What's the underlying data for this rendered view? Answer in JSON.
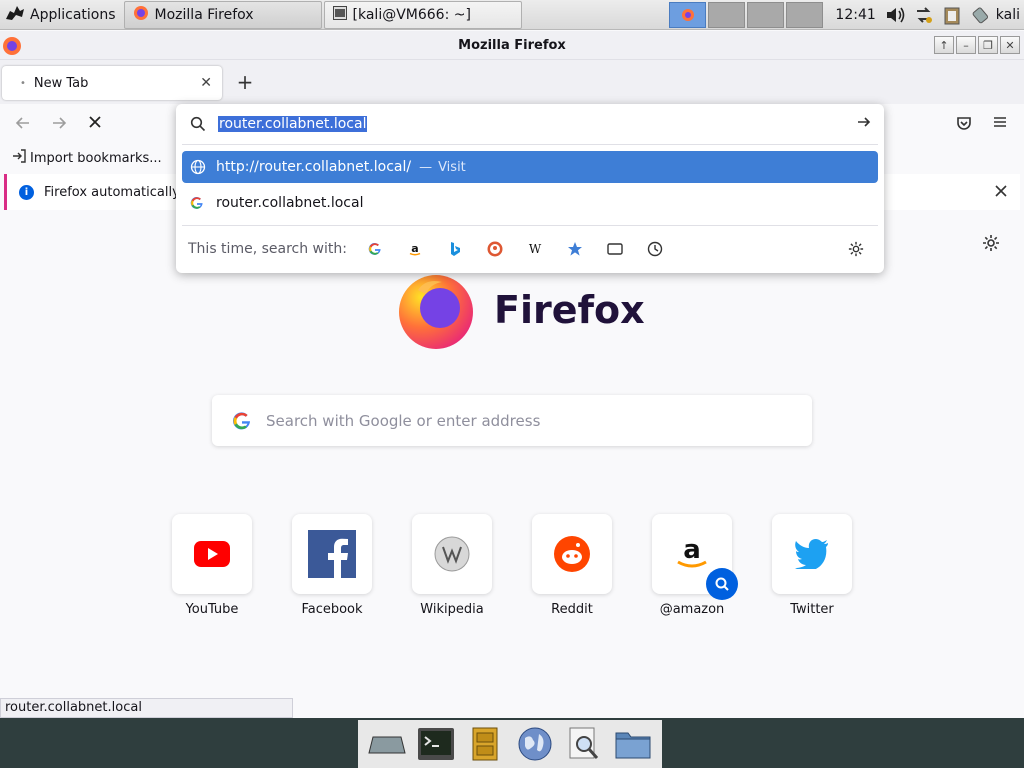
{
  "panel": {
    "apps_label": "Applications",
    "tasks": [
      {
        "label": "Mozilla Firefox",
        "active": true
      },
      {
        "label": "[kali@VM666: ~]",
        "active": false
      }
    ],
    "clock": "12:41",
    "user": "kali"
  },
  "window": {
    "title": "Mozilla Firefox"
  },
  "tabs": [
    {
      "label": "New Tab"
    }
  ],
  "urlbar": {
    "value": "router.collabnet.local",
    "results": [
      {
        "text": "http://router.collabnet.local/",
        "action": "Visit",
        "selected": true,
        "icon": "globe-icon"
      },
      {
        "text": "router.collabnet.local",
        "action": "",
        "selected": false,
        "icon": "google-icon"
      }
    ],
    "search_with_label": "This time, search with:",
    "engines": [
      "google-icon",
      "amazon-icon",
      "bing-icon",
      "duckduckgo-icon",
      "wikipedia-icon",
      "bookmarks-icon",
      "tabs-icon",
      "history-icon"
    ]
  },
  "bookmarks": {
    "import_label": "Import bookmarks..."
  },
  "notification": {
    "text": "Firefox automatically"
  },
  "newtab": {
    "brand": "Firefox",
    "search_placeholder": "Search with Google or enter address",
    "shortcuts": [
      {
        "label": "YouTube",
        "icon": "youtube-icon"
      },
      {
        "label": "Facebook",
        "icon": "facebook-icon"
      },
      {
        "label": "Wikipedia",
        "icon": "wikipedia-icon"
      },
      {
        "label": "Reddit",
        "icon": "reddit-icon"
      },
      {
        "label": "@amazon",
        "icon": "amazon-icon"
      },
      {
        "label": "Twitter",
        "icon": "twitter-icon"
      }
    ]
  },
  "status": {
    "text": "router.collabnet.local"
  },
  "colors": {
    "accent": "#0060df",
    "selection": "#3e7ed6",
    "dock": "#2f3e3e"
  }
}
